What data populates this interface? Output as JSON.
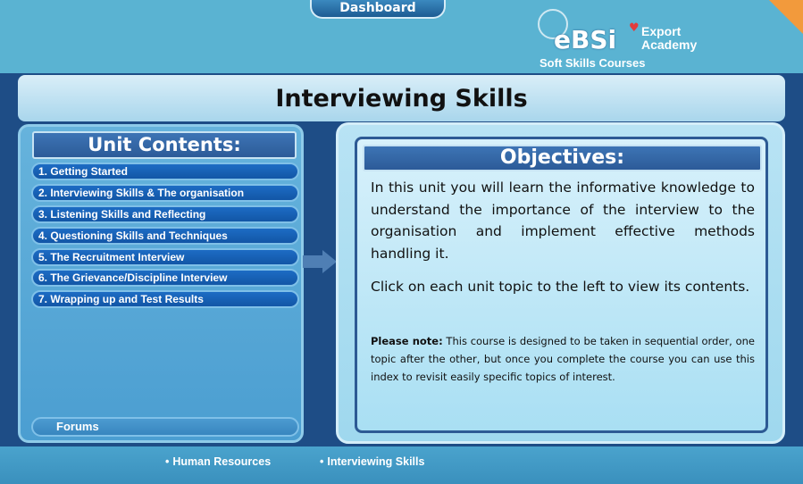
{
  "top": {
    "dashboard_label": "Dashboard"
  },
  "logo": {
    "mark": "eBSi",
    "line1": "Export",
    "line2": "Academy",
    "subtitle": "Soft Skills Courses"
  },
  "page_title": "Interviewing Skills",
  "unit_contents": {
    "header": "Unit Contents:",
    "items": [
      "1. Getting Started",
      "2. Interviewing Skills & The organisation",
      "3. Listening Skills and Reflecting",
      "4. Questioning Skills and Techniques",
      "5. The Recruitment Interview",
      "6. The Grievance/Discipline Interview",
      "7. Wrapping up and Test Results"
    ],
    "forums_label": "Forums"
  },
  "objectives": {
    "header": "Objectives:",
    "paragraph1": "In this unit you will learn the informative knowledge to understand the importance of the interview to the organisation and implement effective methods handling it.",
    "paragraph2": "Click on each unit topic to the left to view its contents.",
    "note_label": "Please note:",
    "note_text": " This course is designed to be taken in sequential order, one topic after the other, but once you complete the course you can use this index to revisit easily specific topics of interest."
  },
  "breadcrumbs": [
    "Human Resources",
    "Interviewing Skills"
  ],
  "icons": {
    "next": "arrow-right-icon",
    "bullet": "bullet-icon"
  },
  "colors": {
    "background": "#1e4d86",
    "top_bar": "#5ab3d2",
    "accent_orange": "#f29a3c",
    "list_item": "#1d6cc4"
  }
}
